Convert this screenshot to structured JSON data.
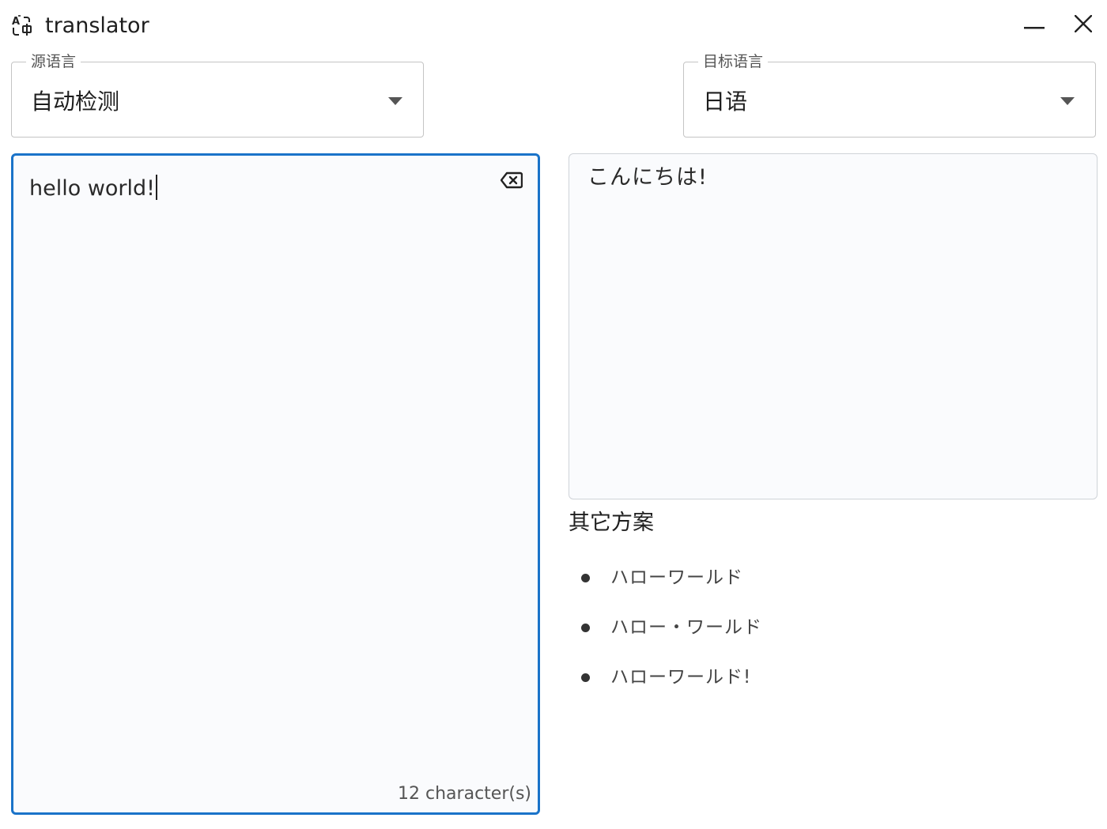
{
  "app": {
    "title": "translator",
    "icon": "translate-icon"
  },
  "window_controls": {
    "minimize_icon": "minimize-icon",
    "close_icon": "close-icon"
  },
  "source_language": {
    "label": "源语言",
    "value": "自动检测"
  },
  "target_language": {
    "label": "目标语言",
    "value": "日语"
  },
  "source_input": {
    "text": "hello world!",
    "char_count": "12 character(s)",
    "clear_icon": "backspace-clear-icon"
  },
  "translation": {
    "text": "こんにちは!"
  },
  "alternatives": {
    "title": "其它方案",
    "items": [
      "ハローワールド",
      "ハロー・ワールド",
      "ハローワールド!"
    ]
  },
  "colors": {
    "accent": "#1a73c9",
    "panel_bg": "#fafbfd"
  }
}
